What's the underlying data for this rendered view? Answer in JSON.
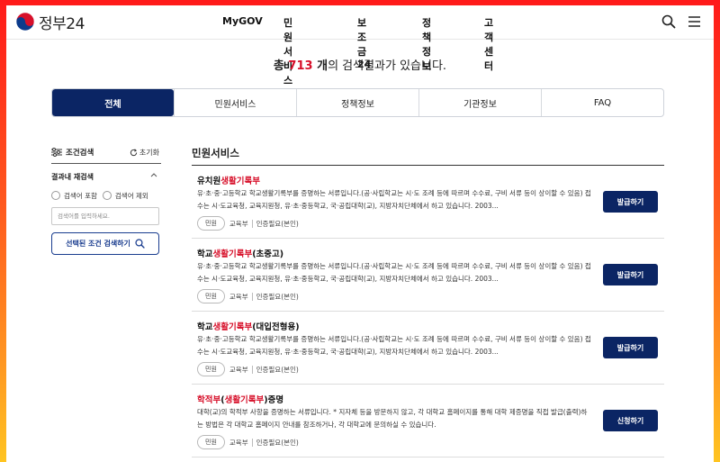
{
  "header": {
    "logo_text": "정부24",
    "nav": [
      "MyGOV",
      "민원서비스",
      "보조금24",
      "정책정보",
      "고객센터"
    ],
    "icons": {
      "search": "search-icon",
      "menu": "hamburger-menu-icon"
    }
  },
  "summary": {
    "prefix": "총 ",
    "count": "713",
    "unit": " 개",
    "suffix": "의 검색결과가 있습니다."
  },
  "tabs": [
    {
      "label": "전체",
      "active": true
    },
    {
      "label": "민원서비스",
      "active": false
    },
    {
      "label": "정책정보",
      "active": false
    },
    {
      "label": "기관정보",
      "active": false
    },
    {
      "label": "FAQ",
      "active": false
    }
  ],
  "sidebar": {
    "title": "조건검색",
    "reset_label": "초기화",
    "refine_title": "결과내 재검색",
    "radio_include": "검색어 포함",
    "radio_exclude": "검색어 제외",
    "keyword_placeholder": "검색어를 입력하세요.",
    "apply_label": "선택된 조건 검색하기"
  },
  "results": {
    "section_title": "민원서비스",
    "items": [
      {
        "title_pre": "유치원",
        "title_hl": "생활기록부",
        "title_post": "",
        "desc": "유·초·중·고등학교 학교생활기록부를 증명하는 서류입니다.(공·사립학교는 시·도 조례 등에 따르며 수수료, 구비 서류 등이 상이할 수 있음) 접수는 시·도교육청, 교육지원청, 유·초·중등학교, 국·공립대학(교), 지방자치단체에서 하고 있습니다. 2003...",
        "tag": "민원",
        "org": "교육부",
        "auth": "인증필요(본인)",
        "action": "발급하기"
      },
      {
        "title_pre": "학교",
        "title_hl": "생활기록부",
        "title_post": "(초중고)",
        "desc": "유·초·중·고등학교 학교생활기록부를 증명하는 서류입니다.(공·사립학교는 시·도 조례 등에 따르며 수수료, 구비 서류 등이 상이할 수 있음) 접수는 시·도교육청, 교육지원청, 유·초·중등학교, 국·공립대학(교), 지방자치단체에서 하고 있습니다. 2003...",
        "tag": "민원",
        "org": "교육부",
        "auth": "인증필요(본인)",
        "action": "발급하기"
      },
      {
        "title_pre": "학교",
        "title_hl": "생활기록부",
        "title_post": "(대입전형용)",
        "desc": "유·초·중·고등학교 학교생활기록부를 증명하는 서류입니다.(공·사립학교는 시·도 조례 등에 따르며 수수료, 구비 서류 등이 상이할 수 있음) 접수는 시·도교육청, 교육지원청, 유·초·중등학교, 국·공립대학(교), 지방자치단체에서 하고 있습니다. 2003...",
        "tag": "민원",
        "org": "교육부",
        "auth": "인증필요(본인)",
        "action": "발급하기"
      },
      {
        "title_pre": "학적부(",
        "title_hl": "생활기록부",
        "title_post": ")증명",
        "title_pre_hl": "학적부",
        "desc": "대학(교)의 학적부 사항을 증명하는 서류입니다. * 지자체 등을 방문하지 않고, 각 대학교 홈페이지를 통해 대학 제증명을 직접 발급(출력)하는 방법은 각 대학교 홈페이지 안내를 참조하거나, 각 대학교에 문의하실 수 있습니다.",
        "tag": "민원",
        "org": "교육부",
        "auth": "인증필요(본인)",
        "action": "신청하기"
      }
    ]
  },
  "colors": {
    "primary": "#0b2564",
    "highlight": "#d7102a"
  }
}
